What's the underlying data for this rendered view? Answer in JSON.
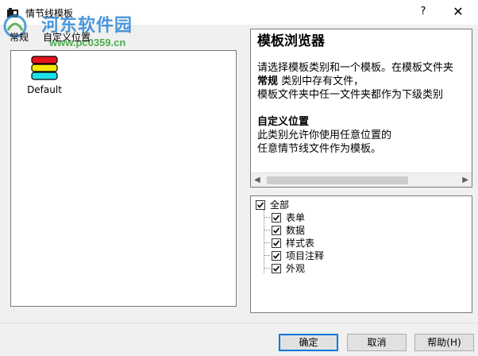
{
  "window": {
    "title": "情节线模板",
    "help_glyph": "?",
    "close_glyph": "✕"
  },
  "watermark": {
    "line1": "河东软件园",
    "line2": "www.pc0359.cn"
  },
  "tabs": [
    {
      "label": "常规"
    },
    {
      "label": "自定义位置"
    }
  ],
  "templates": [
    {
      "label": "Default"
    }
  ],
  "browser": {
    "heading": "模板浏览器",
    "lines": [
      {
        "bold": "",
        "text": "请选择模板类别和一个模板。在模板文件夹"
      },
      {
        "bold": "常规",
        "text": " 类别中存有文件，"
      },
      {
        "bold": "",
        "text": "模板文件夹中任一文件夹都作为下级类别"
      }
    ],
    "section2_title": "自定义位置",
    "section2_lines": [
      "此类别允许你使用任意位置的",
      "任意情节线文件作为模板。"
    ]
  },
  "tree": {
    "root": {
      "label": "全部",
      "checked": true
    },
    "children": [
      {
        "label": "表单",
        "checked": true
      },
      {
        "label": "数据",
        "checked": true
      },
      {
        "label": "样式表",
        "checked": true
      },
      {
        "label": "项目注释",
        "checked": true
      },
      {
        "label": "外观",
        "checked": true
      }
    ]
  },
  "buttons": {
    "ok": "确定",
    "cancel": "取消",
    "help": "帮助(H)"
  },
  "colors": {
    "accent": "#0078d7",
    "watermark_blue": "#2a86d6",
    "watermark_green": "#3aa83a"
  }
}
